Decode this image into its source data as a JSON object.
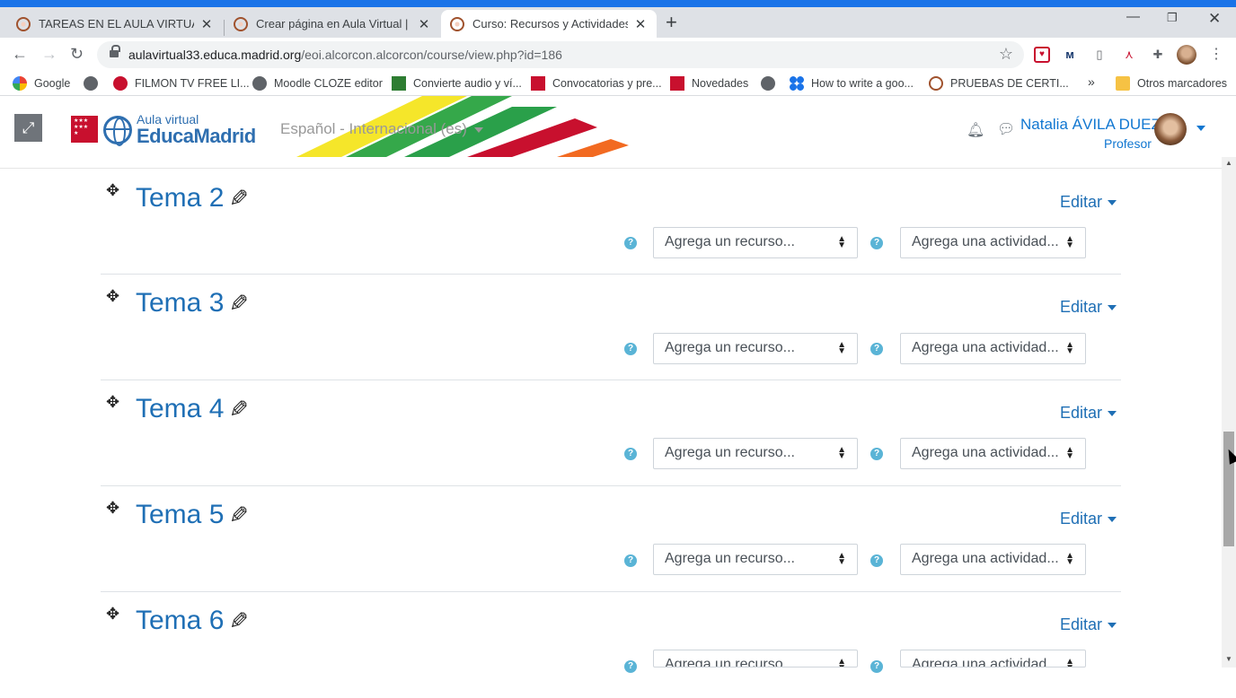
{
  "browser": {
    "tabs": [
      {
        "title": "TAREAS EN EL AULA VIRTUAL: Cr",
        "active": false
      },
      {
        "title": "Crear página en Aula Virtual | Me",
        "active": false
      },
      {
        "title": "Curso: Recursos y Actividades",
        "active": true
      }
    ],
    "url_host": "aulavirtual33.educa.madrid.org",
    "url_path": "/eoi.alcorcon.alcorcon/course/view.php?id=186",
    "bookmarks": [
      {
        "label": "Google"
      },
      {
        "label": ""
      },
      {
        "label": "FILMON TV FREE LI..."
      },
      {
        "label": "Moodle CLOZE editor"
      },
      {
        "label": "Convierte audio y ví..."
      },
      {
        "label": "Convocatorias y pre..."
      },
      {
        "label": "Novedades"
      },
      {
        "label": ""
      },
      {
        "label": "How to write a goo..."
      },
      {
        "label": "PRUEBAS DE CERTI..."
      }
    ],
    "more_bookmarks": "»",
    "other_bookmarks": "Otros marcadores"
  },
  "header": {
    "logo_line1": "Aula virtual",
    "logo_line2": "EducaMadrid",
    "language": "Español - Internacional (es)",
    "user_name": "Natalia ÁVILA DUEZ",
    "user_role": "Profesor"
  },
  "sections": [
    {
      "title": "Tema 2",
      "edit": "Editar",
      "resource": "Agrega un recurso...",
      "activity": "Agrega una actividad..."
    },
    {
      "title": "Tema 3",
      "edit": "Editar",
      "resource": "Agrega un recurso...",
      "activity": "Agrega una actividad..."
    },
    {
      "title": "Tema 4",
      "edit": "Editar",
      "resource": "Agrega un recurso...",
      "activity": "Agrega una actividad..."
    },
    {
      "title": "Tema 5",
      "edit": "Editar",
      "resource": "Agrega un recurso...",
      "activity": "Agrega una actividad..."
    },
    {
      "title": "Tema 6",
      "edit": "Editar",
      "resource": "Agrega un recurso...",
      "activity": "Agrega una actividad..."
    }
  ],
  "colors": {
    "chrome_accent": "#1a73e8",
    "link_blue": "#1f6fb5",
    "help_icon": "#5ab4d6"
  }
}
